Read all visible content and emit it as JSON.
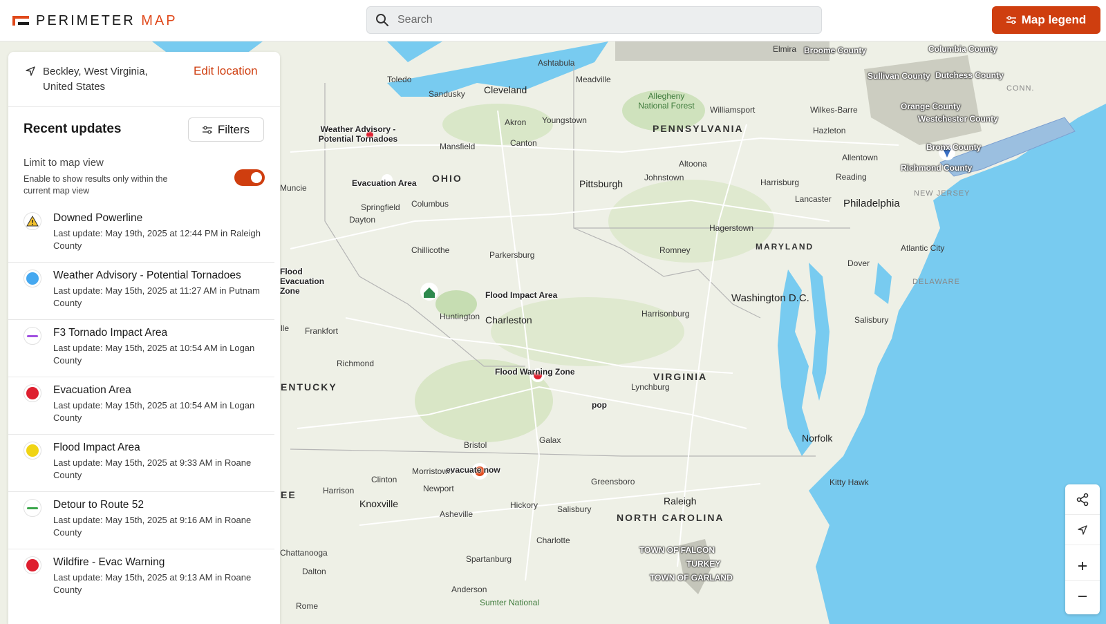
{
  "header": {
    "logo_word1": "PERIMETER",
    "logo_word2": "MAP",
    "search_placeholder": "Search",
    "legend_button": "Map legend"
  },
  "colors": {
    "brand": "#cf3e0f",
    "water": "#78cbf0",
    "land": "#eef0e6"
  },
  "location": {
    "text": "Beckley, West Virginia, United States",
    "edit_label": "Edit location"
  },
  "recent": {
    "title": "Recent updates",
    "filters_label": "Filters",
    "limit_title": "Limit to map view",
    "limit_desc": "Enable to show results only within the current map view",
    "limit_enabled": true
  },
  "updates": [
    {
      "title": "Downed Powerline",
      "meta": "Last update: May 19th, 2025 at 12:44 PM in Raleigh County",
      "icon": "warning-icon",
      "color": "#f2c12e"
    },
    {
      "title": "Weather Advisory - Potential Tornadoes",
      "meta": "Last update: May 15th, 2025 at 11:27 AM in Putnam County",
      "icon": "dot",
      "color": "#45a8f0"
    },
    {
      "title": "F3 Tornado Impact Area",
      "meta": "Last update: May 15th, 2025 at 10:54 AM in Logan County",
      "icon": "line",
      "color": "#a050e0"
    },
    {
      "title": "Evacuation Area",
      "meta": "Last update: May 15th, 2025 at 10:54 AM in Logan County",
      "icon": "dot",
      "color": "#de1f2f"
    },
    {
      "title": "Flood Impact Area",
      "meta": "Last update: May 15th, 2025 at 9:33 AM in Roane County",
      "icon": "dot",
      "color": "#f0d414"
    },
    {
      "title": "Detour to Route 52",
      "meta": "Last update: May 15th, 2025 at 9:16 AM in Roane County",
      "icon": "line",
      "color": "#3aa64a"
    },
    {
      "title": "Wildfire - Evac Warning",
      "meta": "Last update: May 15th, 2025 at 9:13 AM in Roane County",
      "icon": "dot",
      "color": "#de1f2f"
    }
  ],
  "map": {
    "states": [
      "PENNSYLVANIA",
      "OHIO",
      "MARYLAND",
      "VIRGINIA",
      "NORTH CAROLINA",
      "NEW JERSEY",
      "DELAWARE",
      "CONN."
    ],
    "cities": [
      "Cleveland",
      "Toledo",
      "Ashtabula",
      "Akron",
      "Youngstown",
      "Canton",
      "Mansfield",
      "Meadville",
      "Williamsport",
      "Wilkes-Barre",
      "Hazleton",
      "Allentown",
      "Reading",
      "Lancaster",
      "Philadelphia",
      "Harrisburg",
      "Altoona",
      "Johnstown",
      "Pittsburgh",
      "Columbus",
      "Springfield",
      "Dayton",
      "Muncie",
      "Chillicothe",
      "Parkersburg",
      "Hagerstown",
      "Romney",
      "Washington D.C.",
      "Atlantic City",
      "Dover",
      "Salisbury",
      "Harrisonburg",
      "Charleston",
      "Huntington",
      "Frankfort",
      "Richmond",
      "Lynchburg",
      "Norfolk",
      "Bristol",
      "Galax",
      "Morristown",
      "Clinton",
      "Harrison",
      "Newport",
      "Knoxville",
      "Asheville",
      "Hickory",
      "Salisbury",
      "Greensboro",
      "Raleigh",
      "Charlotte",
      "Kitty Hawk",
      "Spartanburg",
      "Chattanooga",
      "Dalton",
      "Anderson",
      "Rome",
      "Elmira",
      "Sandusky"
    ],
    "parks": [
      "Allegheny National Forest",
      "Sumter National"
    ],
    "counties": [
      "Broome County",
      "Columbia County",
      "Sullivan County",
      "Dutchess County",
      "Orange County",
      "Westchester County",
      "Bronx County",
      "Richmond County",
      "TOWN OF FALCON",
      "TURKEY",
      "TOWN OF GARLAND"
    ],
    "overlays": [
      "Weather Advisory - Potential Tornadoes",
      "Evacuation Area",
      "Flood Impact Area",
      "Flood Warning Zone",
      "evacuate now",
      "pop",
      "Flood Evacuation Zone"
    ],
    "partial_labels": [
      "ENTUCKY",
      "EE",
      "lle"
    ]
  },
  "controls": {
    "share": "share-icon",
    "locate": "locate-icon",
    "zoom_in": "plus-icon",
    "zoom_out": "minus-icon"
  }
}
